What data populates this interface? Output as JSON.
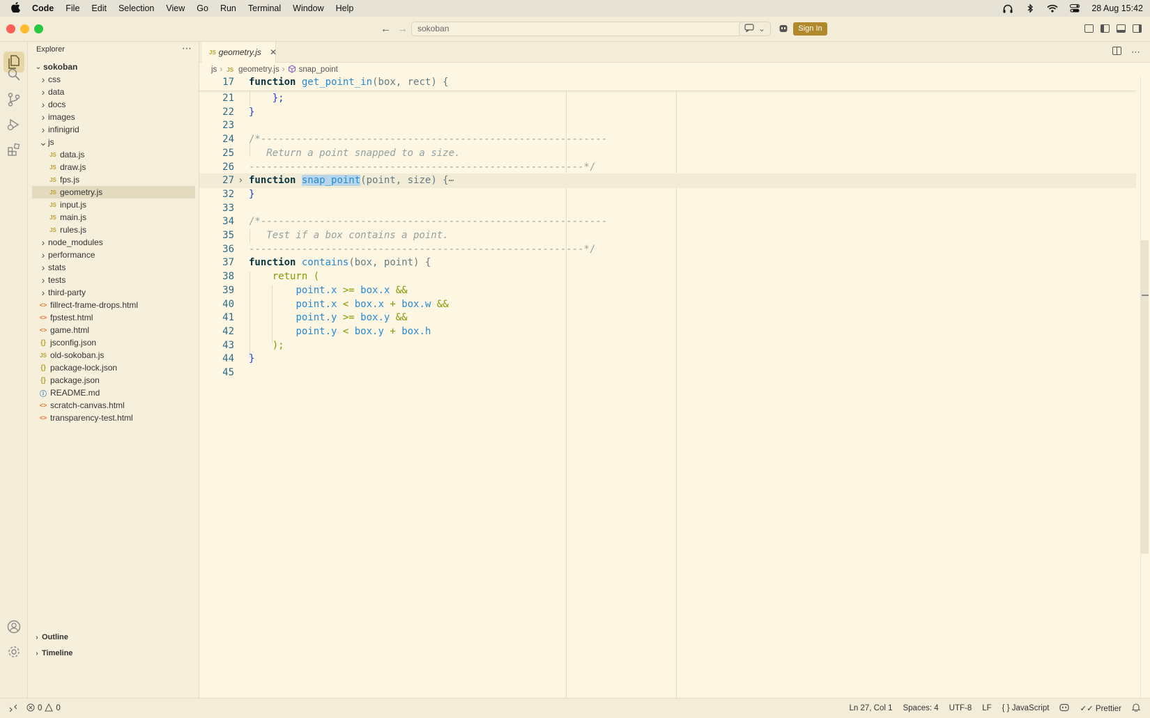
{
  "menubar": {
    "app": "Code",
    "items": [
      "File",
      "Edit",
      "Selection",
      "View",
      "Go",
      "Run",
      "Terminal",
      "Window",
      "Help"
    ],
    "datetime": "28 Aug  15:42"
  },
  "titlebar": {
    "search": "sokoban",
    "sign_in": "Sign In"
  },
  "sidebar": {
    "title": "Explorer",
    "root": "sokoban",
    "items": [
      {
        "label": "css",
        "type": "folder"
      },
      {
        "label": "data",
        "type": "folder"
      },
      {
        "label": "docs",
        "type": "folder"
      },
      {
        "label": "images",
        "type": "folder"
      },
      {
        "label": "infinigrid",
        "type": "folder"
      },
      {
        "label": "js",
        "type": "folder-open"
      },
      {
        "label": "data.js",
        "type": "js",
        "indent": 1
      },
      {
        "label": "draw.js",
        "type": "js",
        "indent": 1
      },
      {
        "label": "fps.js",
        "type": "js",
        "indent": 1
      },
      {
        "label": "geometry.js",
        "type": "js",
        "indent": 1,
        "selected": true
      },
      {
        "label": "input.js",
        "type": "js",
        "indent": 1
      },
      {
        "label": "main.js",
        "type": "js",
        "indent": 1
      },
      {
        "label": "rules.js",
        "type": "js",
        "indent": 1
      },
      {
        "label": "node_modules",
        "type": "folder"
      },
      {
        "label": "performance",
        "type": "folder"
      },
      {
        "label": "stats",
        "type": "folder"
      },
      {
        "label": "tests",
        "type": "folder"
      },
      {
        "label": "third-party",
        "type": "folder"
      },
      {
        "label": "fillrect-frame-drops.html",
        "type": "html"
      },
      {
        "label": "fpstest.html",
        "type": "html"
      },
      {
        "label": "game.html",
        "type": "html"
      },
      {
        "label": "jsconfig.json",
        "type": "json"
      },
      {
        "label": "old-sokoban.js",
        "type": "js"
      },
      {
        "label": "package-lock.json",
        "type": "json"
      },
      {
        "label": "package.json",
        "type": "json"
      },
      {
        "label": "README.md",
        "type": "info"
      },
      {
        "label": "scratch-canvas.html",
        "type": "html"
      },
      {
        "label": "transparency-test.html",
        "type": "html"
      }
    ],
    "outline": "Outline",
    "timeline": "Timeline"
  },
  "editor": {
    "tab_label": "geometry.js",
    "breadcrumbs": [
      "js",
      "geometry.js",
      "snap_point"
    ],
    "sticky_line": {
      "num": "17",
      "kw": "function",
      "name": "get_point_in",
      "rest": "(box, rect) {"
    },
    "lines": [
      {
        "num": "21"
      },
      {
        "num": "22"
      },
      {
        "num": "23"
      },
      {
        "num": "24"
      },
      {
        "num": "25"
      },
      {
        "num": "26"
      },
      {
        "num": "27"
      },
      {
        "num": "32"
      },
      {
        "num": "33"
      },
      {
        "num": "34"
      },
      {
        "num": "35"
      },
      {
        "num": "36"
      },
      {
        "num": "37"
      },
      {
        "num": "38"
      },
      {
        "num": "39"
      },
      {
        "num": "40"
      },
      {
        "num": "41"
      },
      {
        "num": "42"
      },
      {
        "num": "43"
      },
      {
        "num": "44"
      },
      {
        "num": "45"
      }
    ],
    "code": {
      "l21": "    };",
      "l22": "}",
      "l24": "/*-----------------------------------------------------------",
      "l25": "   Return a point snapped to a size.",
      "l26": "---------------------------------------------------------*/",
      "kw_function": "function",
      "snap_name": "snap_point",
      "snap_rest": "(point, size) {",
      "snap_ellipsis": "⋯",
      "l32": "}",
      "l34": "/*-----------------------------------------------------------",
      "l35": "   Test if a box contains a point.",
      "l36": "---------------------------------------------------------*/",
      "contains_name": "contains",
      "contains_rest": "(box, point) {",
      "l38_kw": "return",
      "l38_rest": " (",
      "l39": [
        "point.x",
        " >= ",
        "box.x",
        " &&"
      ],
      "l40": [
        "point.x",
        " < ",
        "box.x",
        " + ",
        "box.w",
        " &&"
      ],
      "l41": [
        "point.y",
        " >= ",
        "box.y",
        " &&"
      ],
      "l42": [
        "point.y",
        " < ",
        "box.y",
        " + ",
        "box.h"
      ],
      "l43": "    );",
      "l44": "}"
    }
  },
  "statusbar": {
    "errors": "0",
    "warnings": "0",
    "position": "Ln 27, Col 1",
    "spaces": "Spaces: 4",
    "encoding": "UTF-8",
    "eol": "LF",
    "language": "JavaScript",
    "formatter": "Prettier"
  },
  "colors": {
    "background": "#fdf6e3",
    "accent": "#b08a2a",
    "keyword": "#073642",
    "function": "#268bd2",
    "comment": "#93a1a1",
    "return": "#859900"
  }
}
